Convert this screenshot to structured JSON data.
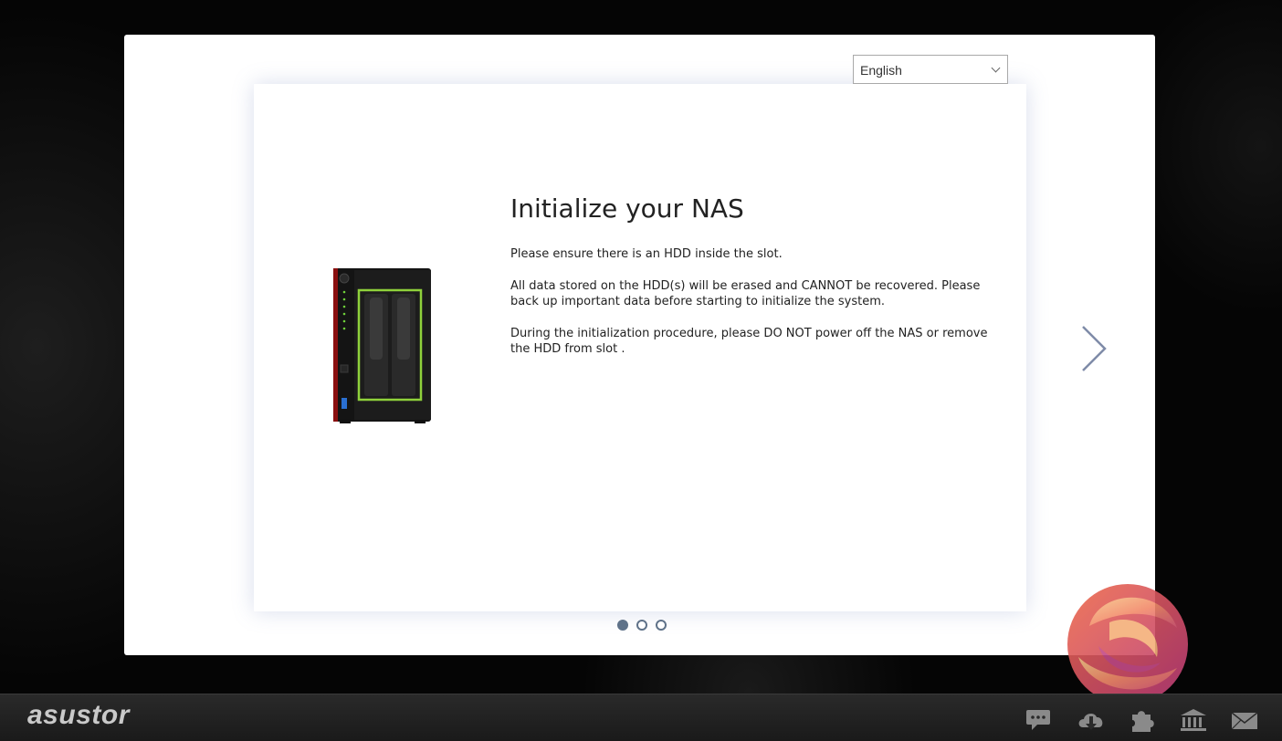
{
  "language_select": {
    "value": "English"
  },
  "slide": {
    "title": "Initialize your NAS",
    "paragraphs": [
      "Please ensure there is an HDD inside the slot.",
      "All data stored on the HDD(s) will be erased and CANNOT be recovered. Please back up important data before starting to initialize the system.",
      "During the initialization procedure, please DO NOT power off the NAS or remove the HDD from slot ."
    ]
  },
  "pagination": {
    "total": 3,
    "current": 1
  },
  "taskbar": {
    "brand": "asustor",
    "icons": [
      "chat-icon",
      "cloud-download-icon",
      "plugin-icon",
      "bank-icon",
      "mail-icon"
    ]
  },
  "colors": {
    "accent": "#5f7289",
    "nas_highlight": "#8fd13b",
    "taskbar": "#222222"
  }
}
